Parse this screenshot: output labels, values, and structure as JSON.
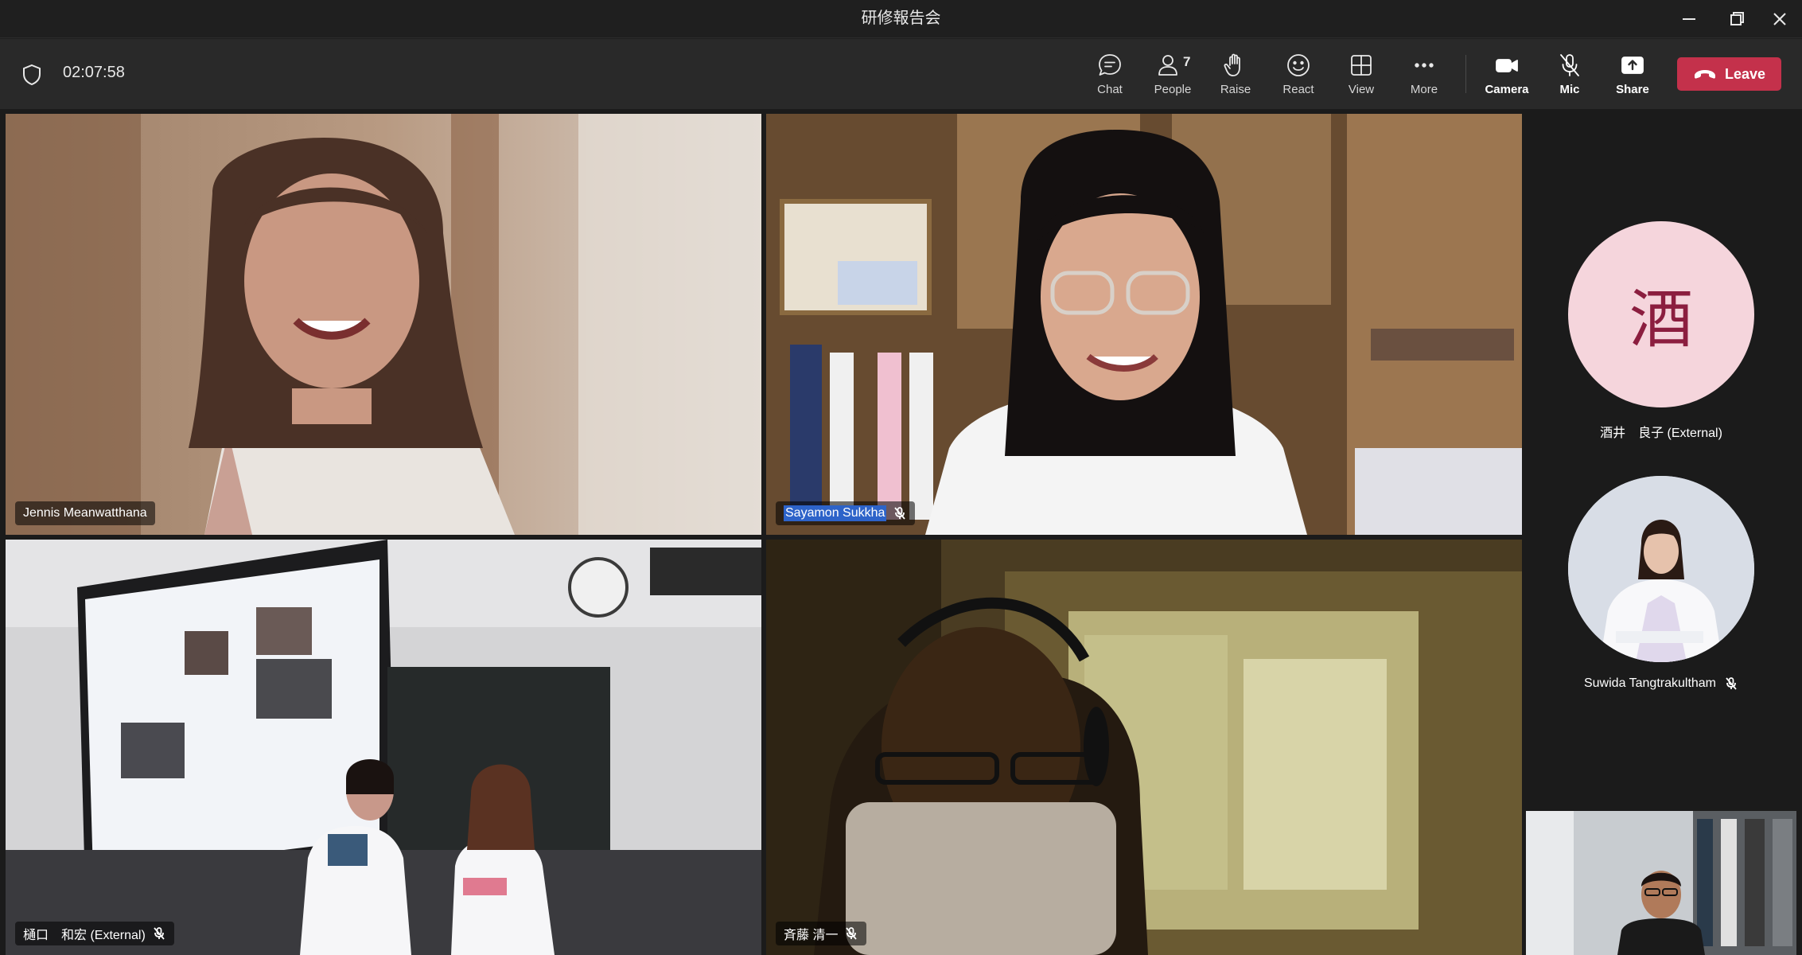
{
  "window": {
    "title": "研修報告会"
  },
  "meeting": {
    "elapsed": "02:07:58",
    "toolbar": {
      "chat": "Chat",
      "people": "People",
      "people_count": "7",
      "raise": "Raise",
      "react": "React",
      "view": "View",
      "more": "More",
      "camera": "Camera",
      "mic": "Mic",
      "share": "Share",
      "leave": "Leave"
    }
  },
  "tiles": [
    {
      "name": "Jennis Meanwatthana",
      "muted": false
    },
    {
      "name": "Sayamon Sukkha",
      "muted": true,
      "highlighted": true
    },
    {
      "name": "樋口　和宏 (External)",
      "muted": true
    },
    {
      "name": "斉藤 清一",
      "muted": true
    }
  ],
  "roster": [
    {
      "initial": "酒",
      "name": "酒井　良子 (External)",
      "muted": false,
      "avatar_color": "#f5d5dc",
      "initial_color": "#8b1e3f"
    },
    {
      "name": "Suwida Tangtrakultham",
      "muted": true
    }
  ],
  "colors": {
    "leave": "#c4314b",
    "highlight": "#2d63c9"
  }
}
